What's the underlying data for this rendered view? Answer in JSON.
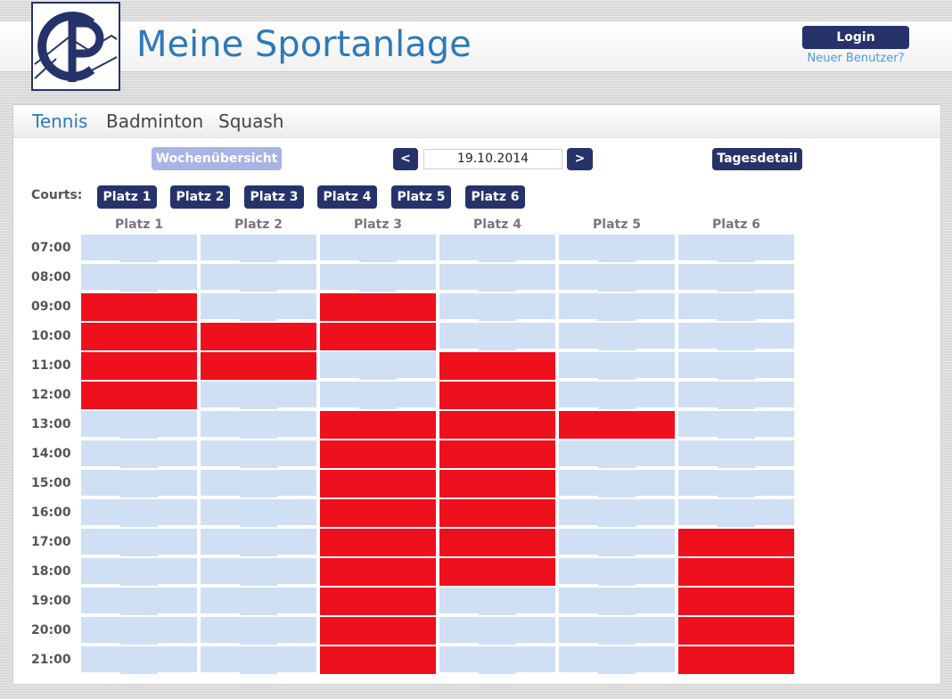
{
  "header": {
    "logo_text": "CP",
    "title": "Meine Sportanlage",
    "login_label": "Login",
    "new_user_label": "Neuer Benutzer?"
  },
  "sports": {
    "tabs": [
      {
        "label": "Tennis",
        "active": true
      },
      {
        "label": "Badminton",
        "active": false
      },
      {
        "label": "Squash",
        "active": false
      }
    ]
  },
  "toolbar": {
    "week_overview_label": "Wochenübersicht",
    "prev_label": "<",
    "date": "19.10.2014",
    "next_label": ">",
    "day_detail_label": "Tagesdetail"
  },
  "courts": {
    "label": "Courts:",
    "buttons": [
      "Platz 1",
      "Platz 2",
      "Platz 3",
      "Platz 4",
      "Platz 5",
      "Platz 6"
    ]
  },
  "schedule": {
    "columns": [
      "Platz 1",
      "Platz 2",
      "Platz 3",
      "Platz 4",
      "Platz 5",
      "Platz 6"
    ],
    "times": [
      "07:00",
      "08:00",
      "09:00",
      "10:00",
      "11:00",
      "12:00",
      "13:00",
      "14:00",
      "15:00",
      "16:00",
      "17:00",
      "18:00",
      "19:00",
      "20:00",
      "21:00"
    ],
    "booked": [
      [
        0,
        0,
        0,
        0,
        0,
        0
      ],
      [
        0,
        0,
        0,
        0,
        0,
        0
      ],
      [
        1,
        0,
        1,
        0,
        0,
        0
      ],
      [
        1,
        1,
        1,
        0,
        0,
        0
      ],
      [
        1,
        1,
        0,
        1,
        0,
        0
      ],
      [
        1,
        0,
        0,
        1,
        0,
        0
      ],
      [
        0,
        0,
        1,
        1,
        1,
        0
      ],
      [
        0,
        0,
        1,
        1,
        0,
        0
      ],
      [
        0,
        0,
        1,
        1,
        0,
        0
      ],
      [
        0,
        0,
        1,
        1,
        0,
        0
      ],
      [
        0,
        0,
        1,
        1,
        0,
        1
      ],
      [
        0,
        0,
        1,
        1,
        0,
        1
      ],
      [
        0,
        0,
        1,
        0,
        0,
        1
      ],
      [
        0,
        0,
        1,
        0,
        0,
        1
      ],
      [
        0,
        0,
        1,
        0,
        0,
        1
      ]
    ]
  },
  "colors": {
    "brand": "#26336b",
    "title": "#2f79b9",
    "link": "#4a9bd8",
    "free": "#cfe0f5",
    "booked": "#ef101e",
    "disabled_button": "#a7b4e4"
  }
}
